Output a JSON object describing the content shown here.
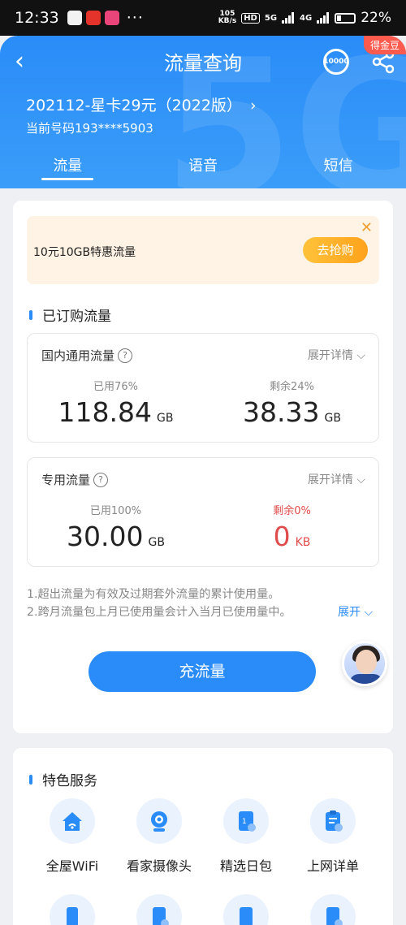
{
  "status": {
    "time": "12:33",
    "dots": "···",
    "speed": "105\nKB/s",
    "hd": "HD",
    "net1": "5G",
    "net2": "4G",
    "battery": "22%"
  },
  "header": {
    "title": "流量查询",
    "badge": "得金豆",
    "icon_10000": "10000",
    "plan": "202112-星卡29元（2022版）",
    "number": "当前号码193****5903",
    "tabs": [
      "流量",
      "语音",
      "短信"
    ]
  },
  "promo": {
    "text": "10元10GB特惠流量",
    "button": "去抢购"
  },
  "subscribed": {
    "title": "已订购流量"
  },
  "domestic": {
    "title": "国内通用流量",
    "expand": "展开详情",
    "used_label": "已用76%",
    "used_value": "118.84",
    "used_unit": "GB",
    "remain_label": "剩余24%",
    "remain_value": "38.33",
    "remain_unit": "GB"
  },
  "special": {
    "title": "专用流量",
    "expand": "展开详情",
    "used_label": "已用100%",
    "used_value": "30.00",
    "used_unit": "GB",
    "remain_label": "剩余0%",
    "remain_value": "0",
    "remain_unit": "KB"
  },
  "notes": {
    "line1": "1.超出流量为有效及过期套外流量的累计使用量。",
    "line2": "2.跨月流量包上月已使用量会计入当月已使用量中。",
    "expand": "展开"
  },
  "cta": {
    "label": "充流量"
  },
  "services": {
    "title": "特色服务",
    "items": [
      {
        "label": "全屋WiFi",
        "icon": "house-wifi-icon"
      },
      {
        "label": "看家摄像头",
        "icon": "camera-icon"
      },
      {
        "label": "精选日包",
        "icon": "daily-package-icon"
      },
      {
        "label": "上网详单",
        "icon": "clipboard-icon"
      }
    ]
  },
  "colors": {
    "primary": "#2a8cf8",
    "accent_orange": "#ffa21b",
    "danger": "#e04b4b"
  }
}
